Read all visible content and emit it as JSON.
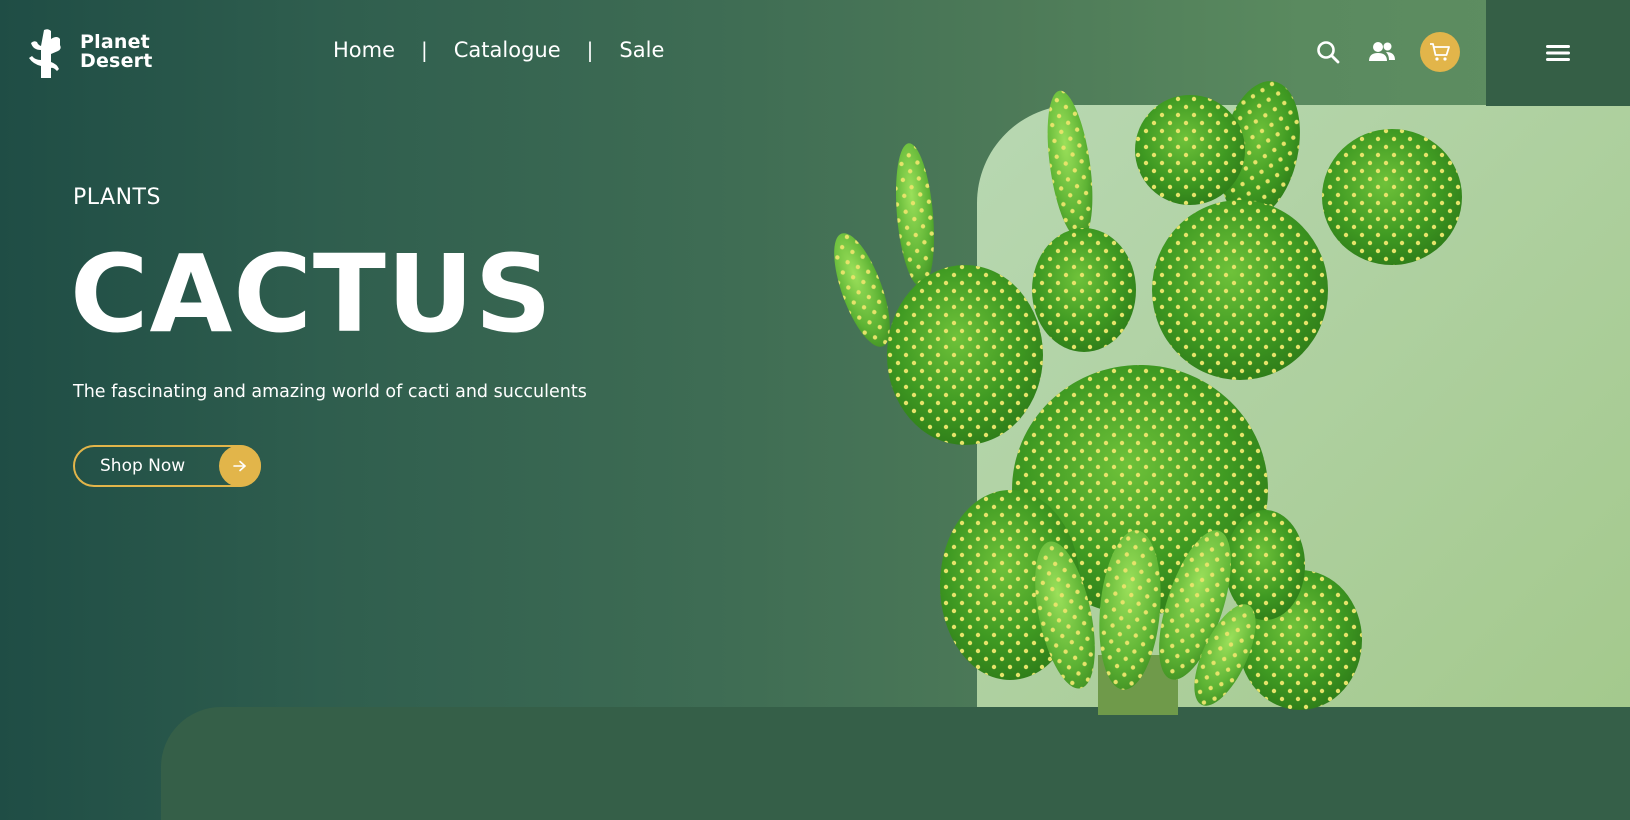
{
  "brand": {
    "line1": "Planet",
    "line2": "Desert",
    "logo_icon": "cactus-icon"
  },
  "nav": {
    "home": "Home",
    "catalogue": "Catalogue",
    "sale": "Sale",
    "separator": "|"
  },
  "header_icons": [
    "search-icon",
    "users-icon",
    "cart-icon",
    "hamburger-menu-icon"
  ],
  "hero": {
    "eyebrow": "PLANTS",
    "title": "CACTUS",
    "subtitle": "The fascinating and amazing world of cacti and succulents",
    "cta_label": "Shop Now",
    "cta_icon": "arrow-right-icon",
    "image": "prickly-pear-cactus-image"
  },
  "colors": {
    "accent": "#e2b54a",
    "background_dark": "#1f4d45",
    "panel_light": "#b8d8b2",
    "menu_block": "#355f46",
    "text": "#ffffff"
  }
}
